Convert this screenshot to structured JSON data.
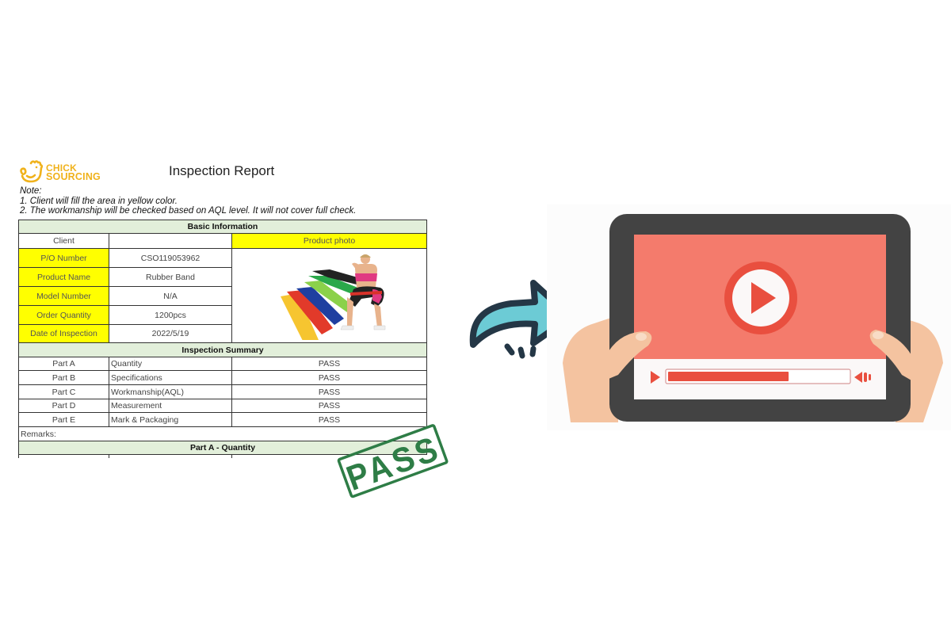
{
  "brand": {
    "logo_line1": "CHICK",
    "logo_line2": "SOURCING",
    "icon": "chicken-logo-icon",
    "color": "#f0b21c"
  },
  "report": {
    "title": "Inspection Report",
    "notes": [
      "Note:",
      "1. Client will fill the area in yellow color.",
      "2. The workmanship will be checked based on AQL level. It will not cover full check."
    ],
    "basic_info": {
      "header": "Basic Information",
      "client_label": "Client",
      "client_value": "",
      "photo_label": "Product photo",
      "photo_icon": "product-photo-resistance-bands",
      "fields": [
        {
          "label": "P/O Number",
          "value": "CSO119053962"
        },
        {
          "label": "Product Name",
          "value": "Rubber Band"
        },
        {
          "label": "Model Number",
          "value": "N/A"
        },
        {
          "label": "Order Quantity",
          "value": "1200pcs"
        },
        {
          "label": "Date of Inspection",
          "value": "2022/5/19"
        }
      ]
    },
    "summary": {
      "header": "Inspection Summary",
      "rows": [
        {
          "part": "Part A",
          "item": "Quantity",
          "result": "PASS"
        },
        {
          "part": "Part B",
          "item": "Specifications",
          "result": "PASS"
        },
        {
          "part": "Part C",
          "item": "Workmanship(AQL)",
          "result": "PASS"
        },
        {
          "part": "Part D",
          "item": "Measurement",
          "result": "PASS"
        },
        {
          "part": "Part E",
          "item": "Mark & Packaging",
          "result": "PASS"
        }
      ],
      "remarks_label": "Remarks:",
      "remarks_value": ""
    },
    "part_a_header": "Part A - Quantity",
    "stamp_text": "PASS",
    "stamp_color": "#2e7d46"
  },
  "arrow": {
    "icon": "curved-arrow-right-icon",
    "fill": "#6ccbd5",
    "stroke": "#243746"
  },
  "video_player": {
    "icon": "tablet-video-player-icon",
    "play_icon": "play-circle-icon",
    "small_play_icon": "play-icon",
    "volume_icon": "volume-icon",
    "progress": 0.67,
    "colors": {
      "bezel": "#434343",
      "screen": "#f47b6c",
      "accent": "#e94f3f",
      "control_bar": "#fbf8f8",
      "skin": "#f4c3a0"
    }
  }
}
